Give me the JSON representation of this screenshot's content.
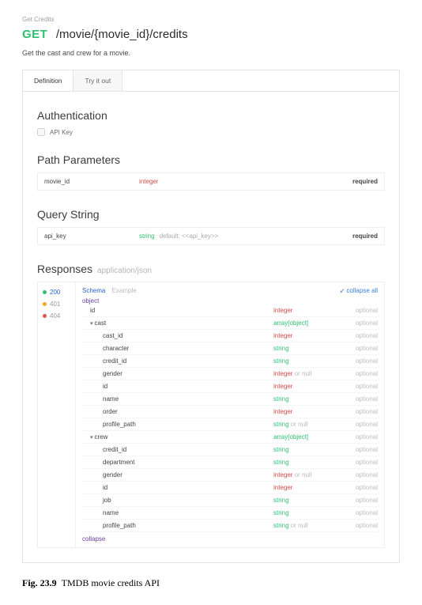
{
  "breadcrumb": "Get Credits",
  "method": "GET",
  "path": "/movie/{movie_id}/credits",
  "description": "Get the cast and crew for a movie.",
  "tabs": {
    "definition": "Definition",
    "try": "Try it out"
  },
  "auth": {
    "title": "Authentication",
    "apikey_label": "API Key"
  },
  "path_params": {
    "title": "Path Parameters",
    "rows": [
      {
        "name": "movie_id",
        "type": "integer",
        "required": "required"
      }
    ]
  },
  "query": {
    "title": "Query String",
    "rows": [
      {
        "name": "api_key",
        "type": "string",
        "default": "default: <<api_key>>",
        "required": "required"
      }
    ]
  },
  "responses": {
    "title": "Responses",
    "subtitle": "application/json",
    "statuses": [
      {
        "code": "200",
        "color": "green",
        "active": true
      },
      {
        "code": "401",
        "color": "orange",
        "active": false
      },
      {
        "code": "404",
        "color": "red",
        "active": false
      }
    ],
    "schema_tab": "Schema",
    "example_tab": "Example",
    "collapse_all": "collapse all",
    "root": "object",
    "fields": [
      {
        "name": "id",
        "type": "integer",
        "tc": "t-int",
        "req": "optional",
        "indent": 0
      },
      {
        "name": "cast",
        "type": "array[object]",
        "tc": "t-arr",
        "req": "optional",
        "indent": 0,
        "caret": true
      },
      {
        "name": "cast_id",
        "type": "integer",
        "tc": "t-int",
        "req": "optional",
        "indent": 1
      },
      {
        "name": "character",
        "type": "string",
        "tc": "t-str",
        "req": "optional",
        "indent": 1
      },
      {
        "name": "credit_id",
        "type": "string",
        "tc": "t-str",
        "req": "optional",
        "indent": 1
      },
      {
        "name": "gender",
        "type": "integer",
        "null": " or null",
        "tc": "t-int",
        "req": "optional",
        "indent": 1
      },
      {
        "name": "id",
        "type": "integer",
        "tc": "t-int",
        "req": "optional",
        "indent": 1
      },
      {
        "name": "name",
        "type": "string",
        "tc": "t-str",
        "req": "optional",
        "indent": 1
      },
      {
        "name": "order",
        "type": "integer",
        "tc": "t-int",
        "req": "optional",
        "indent": 1
      },
      {
        "name": "profile_path",
        "type": "string",
        "null": " or null",
        "tc": "t-str",
        "req": "optional",
        "indent": 1
      },
      {
        "name": "crew",
        "type": "array[object]",
        "tc": "t-arr",
        "req": "optional",
        "indent": 0,
        "caret": true
      },
      {
        "name": "credit_id",
        "type": "string",
        "tc": "t-str",
        "req": "optional",
        "indent": 1
      },
      {
        "name": "department",
        "type": "string",
        "tc": "t-str",
        "req": "optional",
        "indent": 1
      },
      {
        "name": "gender",
        "type": "integer",
        "null": " or null",
        "tc": "t-int",
        "req": "optional",
        "indent": 1
      },
      {
        "name": "id",
        "type": "integer",
        "tc": "t-int",
        "req": "optional",
        "indent": 1
      },
      {
        "name": "job",
        "type": "string",
        "tc": "t-str",
        "req": "optional",
        "indent": 1
      },
      {
        "name": "name",
        "type": "string",
        "tc": "t-str",
        "req": "optional",
        "indent": 1
      },
      {
        "name": "profile_path",
        "type": "string",
        "null": " or null",
        "tc": "t-str",
        "req": "optional",
        "indent": 1
      }
    ],
    "collapse": "collapse"
  },
  "caption": {
    "label": "Fig. 23.9",
    "text": "TMDB movie credits API"
  }
}
